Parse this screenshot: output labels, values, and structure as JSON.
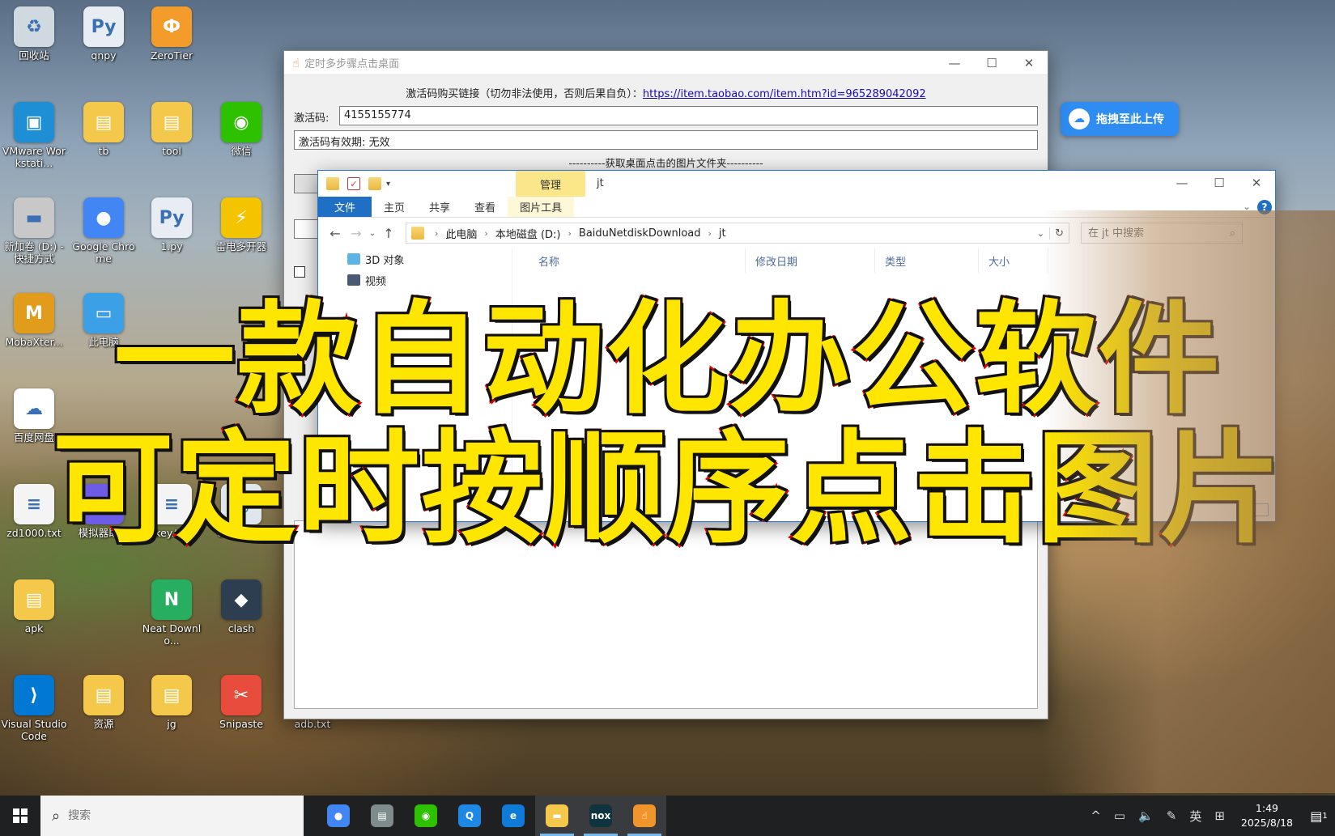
{
  "desktop_icons": [
    {
      "label": "回收站",
      "icon": "recycle-bin-icon",
      "glyph": "♻",
      "color": "#d0d8e0"
    },
    {
      "label": "qnpy",
      "icon": "python-file-icon",
      "glyph": "Py",
      "color": "#e8edf3"
    },
    {
      "label": "ZeroTier",
      "icon": "zerotier-icon",
      "glyph": "Ф",
      "color": "#f39c2b"
    },
    {
      "label": "VMware Workstati...",
      "icon": "vmware-icon",
      "glyph": "▣",
      "color": "#1e8fd5"
    },
    {
      "label": "tb",
      "icon": "folder-icon",
      "glyph": "▤",
      "color": "#f3c84b"
    },
    {
      "label": "tool",
      "icon": "folder-icon",
      "glyph": "▤",
      "color": "#f3c84b"
    },
    {
      "label": "微信",
      "icon": "wechat-icon",
      "glyph": "◉",
      "color": "#2dc100"
    },
    {
      "label": "新加卷 (D:) - 快捷方式",
      "icon": "drive-shortcut-icon",
      "glyph": "▬",
      "color": "#c8c8c8"
    },
    {
      "label": "Google Chrome",
      "icon": "chrome-icon",
      "glyph": "●",
      "color": "#4285f4"
    },
    {
      "label": "1.py",
      "icon": "python-file-icon",
      "glyph": "Py",
      "color": "#e8edf3"
    },
    {
      "label": "雷电多开器",
      "icon": "ldplayer-icon",
      "glyph": "⚡",
      "color": "#f5c400"
    },
    {
      "label": "MobaXter...",
      "icon": "mobaxterm-icon",
      "glyph": "M",
      "color": "#e09c1a"
    },
    {
      "label": "此电脑",
      "icon": "this-pc-icon",
      "glyph": "▭",
      "color": "#3ba0e6"
    },
    {
      "label": "百度网盘",
      "icon": "baidu-netdisk-icon",
      "glyph": "☁",
      "color": "#ffffff"
    },
    {
      "label": "zd1000.txt",
      "icon": "text-file-icon",
      "glyph": "≡",
      "color": "#f4f4f4"
    },
    {
      "label": "模拟器助手",
      "icon": "emulator-helper-icon",
      "glyph": "▦",
      "color": "#6c5ce7"
    },
    {
      "label": "key.txt",
      "icon": "text-file-icon",
      "glyph": "≡",
      "color": "#f4f4f4"
    },
    {
      "label": "UISpy.exe",
      "icon": "exe-icon",
      "glyph": "▢",
      "color": "#dfe6ee"
    },
    {
      "label": "apk",
      "icon": "folder-icon",
      "glyph": "▤",
      "color": "#f3c84b"
    },
    {
      "label": "Neat Downlo...",
      "icon": "neat-download-icon",
      "glyph": "N",
      "color": "#27ae60"
    },
    {
      "label": "clash",
      "icon": "clash-icon",
      "glyph": "◆",
      "color": "#2c3e50"
    },
    {
      "label": "Visual Studio Code",
      "icon": "vscode-icon",
      "glyph": "⟩",
      "color": "#0078d4"
    },
    {
      "label": "资源",
      "icon": "folder-icon",
      "glyph": "▤",
      "color": "#f3c84b"
    },
    {
      "label": "jg",
      "icon": "folder-icon",
      "glyph": "▤",
      "color": "#f3c84b"
    },
    {
      "label": "Snipaste",
      "icon": "snipaste-icon",
      "glyph": "✂",
      "color": "#e74c3c"
    },
    {
      "label": "adb.txt",
      "icon": "text-file-icon",
      "glyph": "≡",
      "color": "#f4f4f4"
    }
  ],
  "app_window": {
    "title": "定时多步骤点击桌面",
    "purchase_text": "激活码购买链接（切勿非法使用，否则后果自负）：",
    "purchase_link": "https://item.taobao.com/item.htm?id=965289042092",
    "activation_label": "激活码:",
    "activation_value": "4155155774",
    "validity_text": "激活码有效期: 无效",
    "folder_divider": "----------获取桌面点击的图片文件夹----------"
  },
  "explorer": {
    "title": "jt",
    "manage_tab": "管理",
    "ribbon_tabs": [
      "文件",
      "主页",
      "共享",
      "查看",
      "图片工具"
    ],
    "breadcrumb": [
      "此电脑",
      "本地磁盘 (D:)",
      "BaiduNetdiskDownload",
      "jt"
    ],
    "search_placeholder": "在 jt 中搜索",
    "nav_items": [
      "3D 对象",
      "视频"
    ],
    "columns": [
      "名称",
      "修改日期",
      "类型",
      "大小"
    ]
  },
  "float_upload": {
    "label": "拖拽至此上传"
  },
  "headline": {
    "line1": "一款自动化办公软件",
    "line2": "可定时按顺序点击图片"
  },
  "taskbar": {
    "search_placeholder": "搜索",
    "apps": [
      {
        "icon": "chrome-icon",
        "glyph": "●",
        "color": "#4285f4"
      },
      {
        "icon": "explorer-manager-icon",
        "glyph": "▤",
        "color": "#7f8c8d"
      },
      {
        "icon": "wechat-icon",
        "glyph": "◉",
        "color": "#2dc100"
      },
      {
        "icon": "qq-icon",
        "glyph": "Q",
        "color": "#1e88e5"
      },
      {
        "icon": "edge-icon",
        "glyph": "e",
        "color": "#0f7bd8"
      },
      {
        "icon": "file-explorer-icon",
        "glyph": "▬",
        "color": "#f3c84b"
      },
      {
        "icon": "nox-icon",
        "glyph": "nox",
        "color": "#10343d"
      },
      {
        "icon": "clicker-app-icon",
        "glyph": "☝",
        "color": "#f0952b"
      }
    ],
    "ime": "英",
    "time": "1:49",
    "date": "2025/8/18",
    "notification_count": "1"
  }
}
